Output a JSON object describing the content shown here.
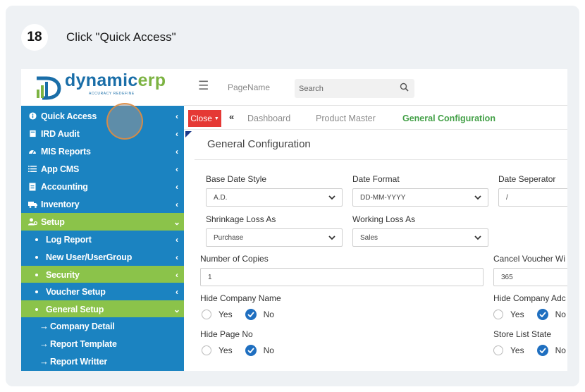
{
  "step": {
    "number": "18",
    "instruction": "Click \"Quick Access\""
  },
  "logo": {
    "name_main": "dynamic",
    "name_accent": "erp",
    "tagline": "ACCURACY REDEFINE"
  },
  "sidebar": {
    "items": [
      {
        "label": "Quick Access",
        "icon": "info-circle-icon"
      },
      {
        "label": "IRD Audit",
        "icon": "book-icon"
      },
      {
        "label": "MIS Reports",
        "icon": "dashboard-icon"
      },
      {
        "label": "App CMS",
        "icon": "list-icon"
      },
      {
        "label": "Accounting",
        "icon": "document-icon"
      },
      {
        "label": "Inventory",
        "icon": "truck-icon"
      },
      {
        "label": "Setup",
        "icon": "users-gear-icon"
      },
      {
        "label": "Log Report"
      },
      {
        "label": "New User/UserGroup"
      },
      {
        "label": "Security"
      },
      {
        "label": "Voucher Setup"
      },
      {
        "label": "General Setup"
      },
      {
        "label": "Company Detail"
      },
      {
        "label": "Report Template"
      },
      {
        "label": "Report Writter"
      }
    ]
  },
  "topbar": {
    "page_name": "PageName",
    "search_placeholder": "Search"
  },
  "tabs": {
    "close_label": "Close",
    "items": [
      "Dashboard",
      "Product Master",
      "General Configuration"
    ],
    "active": "General Configuration"
  },
  "form": {
    "title": "General Configuration",
    "base_date_style": {
      "label": "Base Date Style",
      "value": "A.D."
    },
    "date_format": {
      "label": "Date Format",
      "value": "DD-MM-YYYY"
    },
    "date_separator": {
      "label": "Date Seperator",
      "value": "/"
    },
    "shrinkage_loss_as": {
      "label": "Shrinkage Loss As",
      "value": "Purchase"
    },
    "working_loss_as": {
      "label": "Working Loss As",
      "value": "Sales"
    },
    "number_of_copies": {
      "label": "Number of Copies",
      "value": "1"
    },
    "cancel_voucher": {
      "label": "Cancel Voucher Wi",
      "value": "365"
    },
    "hide_company_name": {
      "label": "Hide Company Name",
      "yes": "Yes",
      "no": "No",
      "selected": "No"
    },
    "hide_company_addr": {
      "label": "Hide Company Adc",
      "yes": "Yes",
      "no": "No",
      "selected": "No"
    },
    "hide_page_no": {
      "label": "Hide Page No",
      "yes": "Yes",
      "no": "No",
      "selected": "No"
    },
    "store_list_state": {
      "label": "Store List State",
      "yes": "Yes",
      "no": "No",
      "selected": "No"
    }
  },
  "colors": {
    "sidebar_blue": "#1b83c1",
    "sidebar_green": "#8bc34a",
    "close_red": "#e53935",
    "active_tab_green": "#43a047",
    "radio_blue": "#1f6fc0"
  }
}
